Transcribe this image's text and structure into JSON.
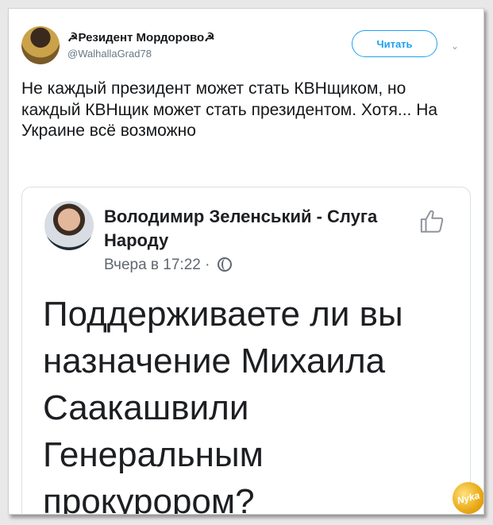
{
  "tweet": {
    "display_name": "☭Резидент Мордорово☭",
    "username": "@WalhallaGrad78",
    "follow_label": "Читать",
    "text": "Не каждый президент может стать КВНщиком, но каждый КВНщик может стать президентом. Хотя... На Украине всё возможно"
  },
  "embed": {
    "author": "Володимир Зеленський - Слуга Народу",
    "time": "Вчера в 17:22 ·",
    "post_text": "Поддерживаете ли вы назначение Михаила Саакашвили Генеральным прокурором?"
  },
  "watermark": {
    "text": "Nyka"
  },
  "icons": {
    "avatar": "user-avatar",
    "chevron": "chevron-down-icon",
    "like": "thumbs-up-icon",
    "globe": "globe-icon"
  },
  "colors": {
    "accent": "#1da1f2",
    "background": "#ffffff"
  }
}
